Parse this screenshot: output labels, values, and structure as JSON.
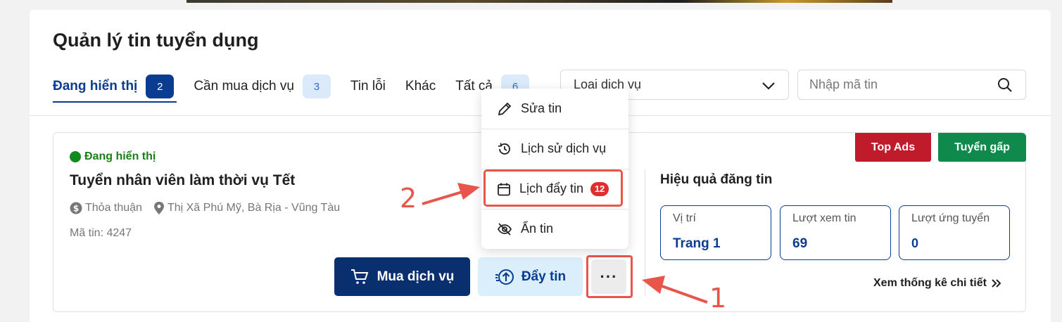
{
  "page": {
    "title": "Quản lý tin tuyển dụng"
  },
  "tabs": [
    {
      "label": "Đang hiển thị",
      "count": "2",
      "active": true
    },
    {
      "label": "Cần mua dịch vụ",
      "count": "3"
    },
    {
      "label": "Tin lỗi"
    },
    {
      "label": "Khác"
    },
    {
      "label": "Tất cả",
      "count": "6"
    }
  ],
  "filters": {
    "service_type_value": "Loại dịch vụ",
    "search_placeholder": "Nhập mã tin"
  },
  "job": {
    "status": "Đang hiển thị",
    "title": "Tuyển nhân viên làm thời vụ Tết",
    "salary": "Thỏa thuận",
    "location": "Thị Xã Phú Mỹ, Bà Rịa - Vũng Tàu",
    "code": "Mã tin: 4247",
    "buy_service_label": "Mua dịch vụ",
    "push_label": "Đẩy tin",
    "more_label": "···",
    "tags": {
      "top_ads": "Top Ads",
      "urgent": "Tuyển gấp"
    }
  },
  "stats": {
    "title": "Hiệu quả đăng tin",
    "items": [
      {
        "label": "Vị trí",
        "value": "Trang 1"
      },
      {
        "label": "Lượt xem tin",
        "value": "69"
      },
      {
        "label": "Lượt ứng tuyển",
        "value": "0"
      }
    ],
    "detail_link": "Xem thống kê chi tiết"
  },
  "menu": {
    "items": [
      {
        "label": "Sửa tin",
        "icon": "pencil-icon"
      },
      {
        "label": "Lịch sử dịch vụ",
        "icon": "history-icon"
      },
      {
        "label": "Lịch đẩy tin",
        "icon": "calendar-icon",
        "badge": "12"
      },
      {
        "label": "Ẩn tin",
        "icon": "eye-off-icon"
      }
    ]
  },
  "annotations": {
    "step1": "1",
    "step2": "2"
  },
  "colors": {
    "primary": "#0a3d91",
    "primary_dark": "#0a2f6f",
    "status_green": "#118a1e",
    "top_ads": "#c01b2a",
    "urgent": "#0f8a4c",
    "annotation": "#e8564b"
  }
}
